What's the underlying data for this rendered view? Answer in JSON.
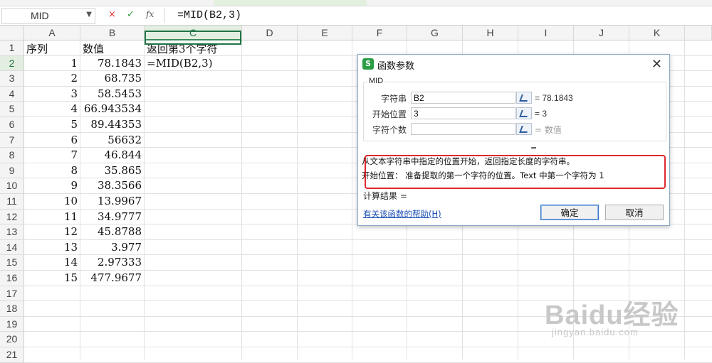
{
  "formula_bar": {
    "name_box": "MID",
    "cancel_glyph": "×",
    "enter_glyph": "✓",
    "fx_label": "fx",
    "formula": "=MID(B2,3)"
  },
  "sheet": {
    "columns": [
      "A",
      "B",
      "C",
      "D",
      "E",
      "F",
      "G",
      "H",
      "I",
      "J",
      "K"
    ],
    "row_numbers": [
      "1",
      "2",
      "3",
      "4",
      "5",
      "6",
      "7",
      "8",
      "9",
      "10",
      "11",
      "12",
      "13",
      "14",
      "15",
      "16",
      "17",
      "18",
      "19",
      "20",
      "21"
    ],
    "header_row": {
      "a": "序列",
      "b": "数值",
      "c": "返回第3个字符"
    },
    "rows": [
      {
        "a": "1",
        "b": "78.1843",
        "c": "=MID(B2,3)"
      },
      {
        "a": "2",
        "b": "68.735"
      },
      {
        "a": "3",
        "b": "58.5453"
      },
      {
        "a": "4",
        "b": "66.943534"
      },
      {
        "a": "5",
        "b": "89.44353"
      },
      {
        "a": "6",
        "b": "56632"
      },
      {
        "a": "7",
        "b": "46.844"
      },
      {
        "a": "8",
        "b": "35.865"
      },
      {
        "a": "9",
        "b": "38.3566"
      },
      {
        "a": "10",
        "b": "13.9967"
      },
      {
        "a": "11",
        "b": "34.9777"
      },
      {
        "a": "12",
        "b": "45.8788"
      },
      {
        "a": "13",
        "b": "3.977"
      },
      {
        "a": "14",
        "b": "2.97333"
      },
      {
        "a": "15",
        "b": "477.9677"
      }
    ],
    "selected_column": "C",
    "selected_row": "2"
  },
  "dialog": {
    "logo": "S",
    "title": "函数参数",
    "close": "✕",
    "function_name": "MID",
    "args": [
      {
        "label": "字符串",
        "value": "B2",
        "result": "= 78.1843"
      },
      {
        "label": "开始位置",
        "value": "3",
        "result": "= 3"
      },
      {
        "label": "字符个数",
        "value": "",
        "result": "= 数值"
      }
    ],
    "equals": "=",
    "description": "从文本字符串中指定的位置开始，返回指定长度的字符串。",
    "param_help": "开始位置： 准备提取的第一个字符的位置。Text 中第一个字符为 1",
    "result_label": "计算结果 =",
    "help_link": "有关该函数的帮助(H)",
    "ok": "确定",
    "cancel": "取消"
  },
  "watermark": {
    "brand": "Baidu经验",
    "url": "jingyan.baidu.com"
  },
  "colors": {
    "accent_green": "#217346",
    "highlight_red": "#e0282e",
    "link_blue": "#1a4fb5"
  }
}
